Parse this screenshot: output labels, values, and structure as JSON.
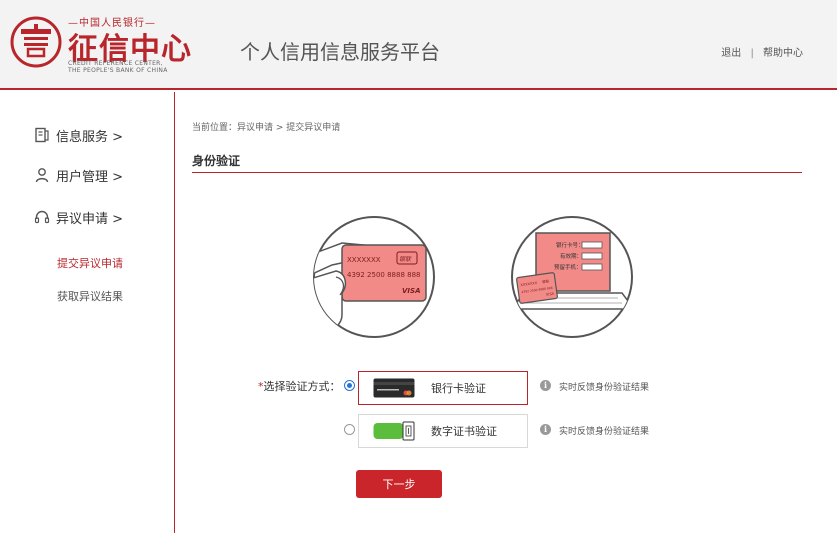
{
  "header": {
    "logo_top": "—中国人民银行—",
    "logo_main": "征信中心",
    "logo_en1": "CREDIT REFERENCE CENTER,",
    "logo_en2": "THE PEOPLE'S BANK OF CHINA",
    "platform_title": "个人信用信息服务平台",
    "links": {
      "logout": "退出",
      "separator": "|",
      "help": "帮助中心"
    },
    "brand_color": "#b8262b"
  },
  "sidebar": {
    "items": [
      {
        "label": "信息服务 >",
        "icon": "document-icon"
      },
      {
        "label": "用户管理 >",
        "icon": "user-icon"
      },
      {
        "label": "异议申请 >",
        "icon": "headset-icon"
      }
    ],
    "subitems": [
      {
        "label": "提交异议申请",
        "active": true
      },
      {
        "label": "获取异议结果",
        "active": false
      }
    ]
  },
  "main": {
    "breadcrumb": "当前位置：异议申请 > 提交异议申请",
    "section_title": "身份验证",
    "illustration1": {
      "card_name": "XXXXXXX",
      "card_logo": "银联",
      "card_number": "4392 2500 8888 888",
      "card_brand": "VISA"
    },
    "illustration2": {
      "fields": [
        "银行卡号：",
        "有效期：",
        "预留手机："
      ],
      "mini_card_name": "XXXXXXX",
      "mini_card_logo": "银联",
      "mini_card_number": "4392 2500 8888 888",
      "mini_card_brand": "VISA"
    },
    "form": {
      "required_mark": "*",
      "label": "选择验证方式：",
      "options": [
        {
          "label": "银行卡验证",
          "info": "实时反馈身份验证结果",
          "selected": true,
          "icon": "bank-card-icon"
        },
        {
          "label": "数字证书验证",
          "info": "实时反馈身份验证结果",
          "selected": false,
          "icon": "usb-key-icon"
        }
      ],
      "info_glyph": "i"
    },
    "next_button": "下一步"
  }
}
